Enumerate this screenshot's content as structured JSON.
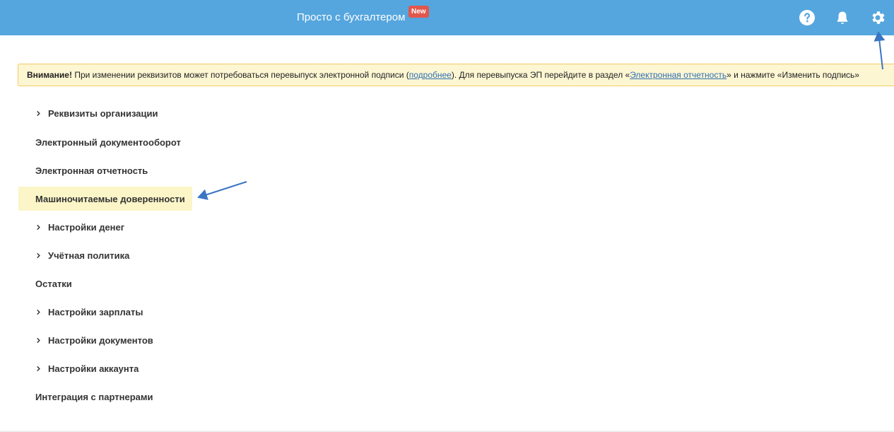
{
  "header": {
    "title": "Просто с бухгалтером",
    "badge": "New",
    "icons": [
      "help-icon",
      "bell-icon",
      "gear-icon"
    ]
  },
  "alert": {
    "bold": "Внимание!",
    "text1": " При изменении реквизитов может потребоваться перевыпуск электронной подписи (",
    "link1": "подробнее",
    "text2": "). Для перевыпуска ЭП перейдите в раздел «",
    "link2": "Электронная отчетность",
    "text3": "» и нажмите «Изменить подпись»"
  },
  "menu": {
    "items": [
      {
        "label": "Реквизиты организации",
        "expandable": true
      },
      {
        "label": "Электронный документооборот",
        "expandable": false
      },
      {
        "label": "Электронная отчетность",
        "expandable": false
      },
      {
        "label": "Машиночитаемые доверенности",
        "expandable": false,
        "highlighted": true
      },
      {
        "label": "Настройки денег",
        "expandable": true
      },
      {
        "label": "Учётная политика",
        "expandable": true
      },
      {
        "label": "Остатки",
        "expandable": false
      },
      {
        "label": "Настройки зарплаты",
        "expandable": true
      },
      {
        "label": "Настройки документов",
        "expandable": true
      },
      {
        "label": "Настройки аккаунта",
        "expandable": true
      },
      {
        "label": "Интеграция с партнерами",
        "expandable": false
      }
    ]
  },
  "colors": {
    "header_bg": "#55a6de",
    "badge_bg": "#e2574c",
    "alert_bg": "#fdf6d3",
    "alert_border": "#f1cc63",
    "highlight_bg": "#fbf5c8",
    "link": "#2f6fb2",
    "annotation_arrow": "#3a75c4"
  }
}
